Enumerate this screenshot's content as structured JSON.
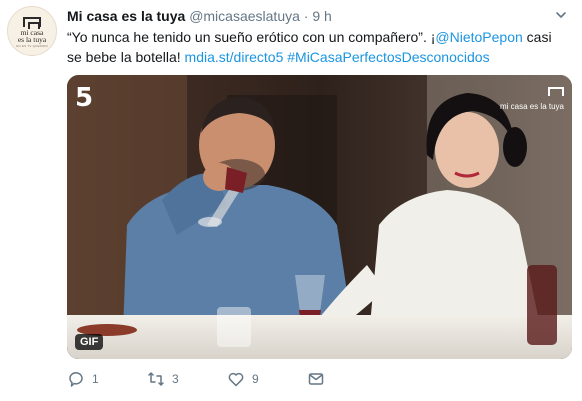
{
  "tweet": {
    "display_name": "Mi casa es la tuya",
    "handle": "@micasaeslatuya",
    "separator": "·",
    "time": "9 h",
    "text_main": "“Yo nunca he tenido un sueño erótico con un compañero”. ¡",
    "mention": "@NietoPepon",
    "text_after": " casi se bebe la botella! ",
    "url": "mdia.st/directo5",
    "hashtag": " #MiCasaPerfectosDesconocidos"
  },
  "avatar": {
    "line1": "mi casa",
    "line2": "es la tuya",
    "sub": "NO ES TV QUERIDO"
  },
  "media": {
    "gif_label": "GIF",
    "channel_logo": "5",
    "watermark": "mi casa es la tuya"
  },
  "actions": {
    "replies": "1",
    "retweets": "3",
    "likes": "9"
  },
  "colors": {
    "link": "#1b95e0",
    "secondary": "#657786"
  }
}
